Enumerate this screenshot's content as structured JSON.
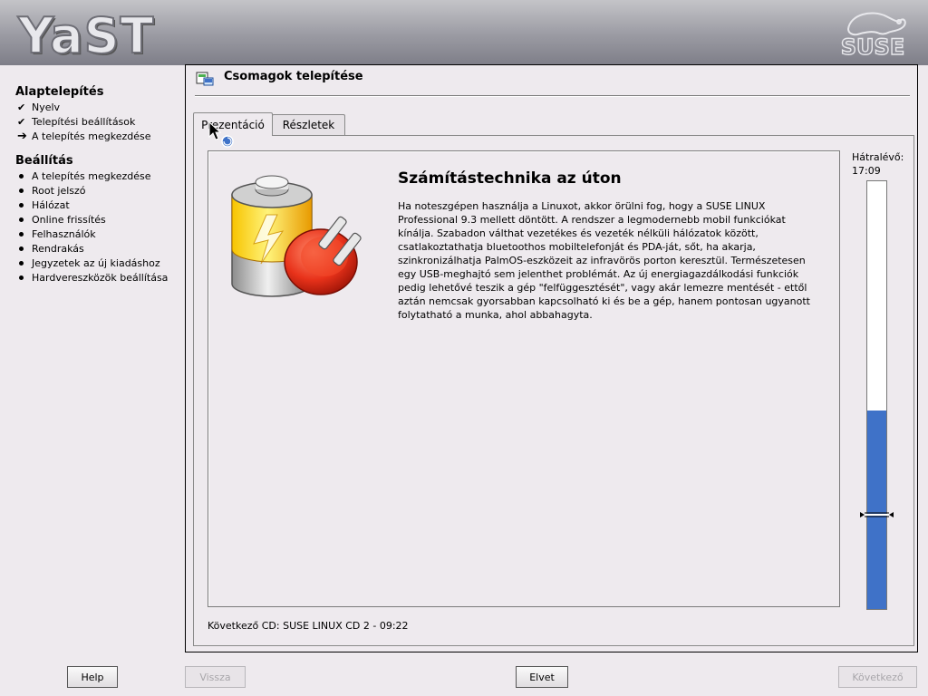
{
  "header": {
    "app_logo_text": "YaST",
    "vendor_logo_text": "SUSE"
  },
  "sidebar": {
    "section1_title": "Alaptelepítés",
    "section1_items": [
      {
        "label": "Nyelv",
        "state": "done"
      },
      {
        "label": "Telepítési beállítások",
        "state": "done"
      },
      {
        "label": "A telepítés megkezdése",
        "state": "current"
      }
    ],
    "section2_title": "Beállítás",
    "section2_items": [
      {
        "label": "A telepítés megkezdése",
        "state": "pending"
      },
      {
        "label": "Root jelszó",
        "state": "pending"
      },
      {
        "label": "Hálózat",
        "state": "pending"
      },
      {
        "label": "Online frissítés",
        "state": "pending"
      },
      {
        "label": "Felhasználók",
        "state": "pending"
      },
      {
        "label": "Rendrakás",
        "state": "pending"
      },
      {
        "label": "Jegyzetek az új kiadáshoz",
        "state": "pending"
      },
      {
        "label": "Hardvereszközök beállítása",
        "state": "pending"
      }
    ]
  },
  "main": {
    "title": "Csomagok telepítése",
    "tabs": [
      {
        "label": "Prezentáció",
        "active": true
      },
      {
        "label": "Részletek",
        "active": false
      }
    ],
    "slide": {
      "heading": "Számítástechnika az úton",
      "text": "Ha noteszgépen használja a Linuxot, akkor örülni fog, hogy a SUSE LINUX Professional 9.3 mellett döntött. A rendszer a legmodernebb mobil funkciókat kínálja. Szabadon válthat vezetékes és vezeték nélküli hálózatok között, csatlakoztathatja bluetoothos mobiltelefonját és PDA-ját, sőt, ha akarja, szinkronizálhatja PalmOS-eszközeit az infravörös porton keresztül. Természetesen egy USB-meghajtó sem jelenthet problémát. Az új energiagazdálkodási funkciók pedig lehetővé teszik a gép \"felfüggesztését\", vagy akár lemezre mentését - ettől aztán nemcsak gyorsabban kapcsolható ki és be a gép, hanem pontosan ugyanott folytatható a munka, ahol abbahagyta."
    },
    "remaining_label": "Hátralévő:",
    "remaining_time": "17:09",
    "progress_fraction": 0.465,
    "marker_fraction": 0.22,
    "next_cd": "Következő CD: SUSE LINUX CD 2 - 09:22"
  },
  "buttons": {
    "help": "Help",
    "back": "Vissza",
    "abort": "Elvet",
    "next": "Következő"
  },
  "colors": {
    "progress": "#3f72c8",
    "background": "#eeeaee"
  }
}
